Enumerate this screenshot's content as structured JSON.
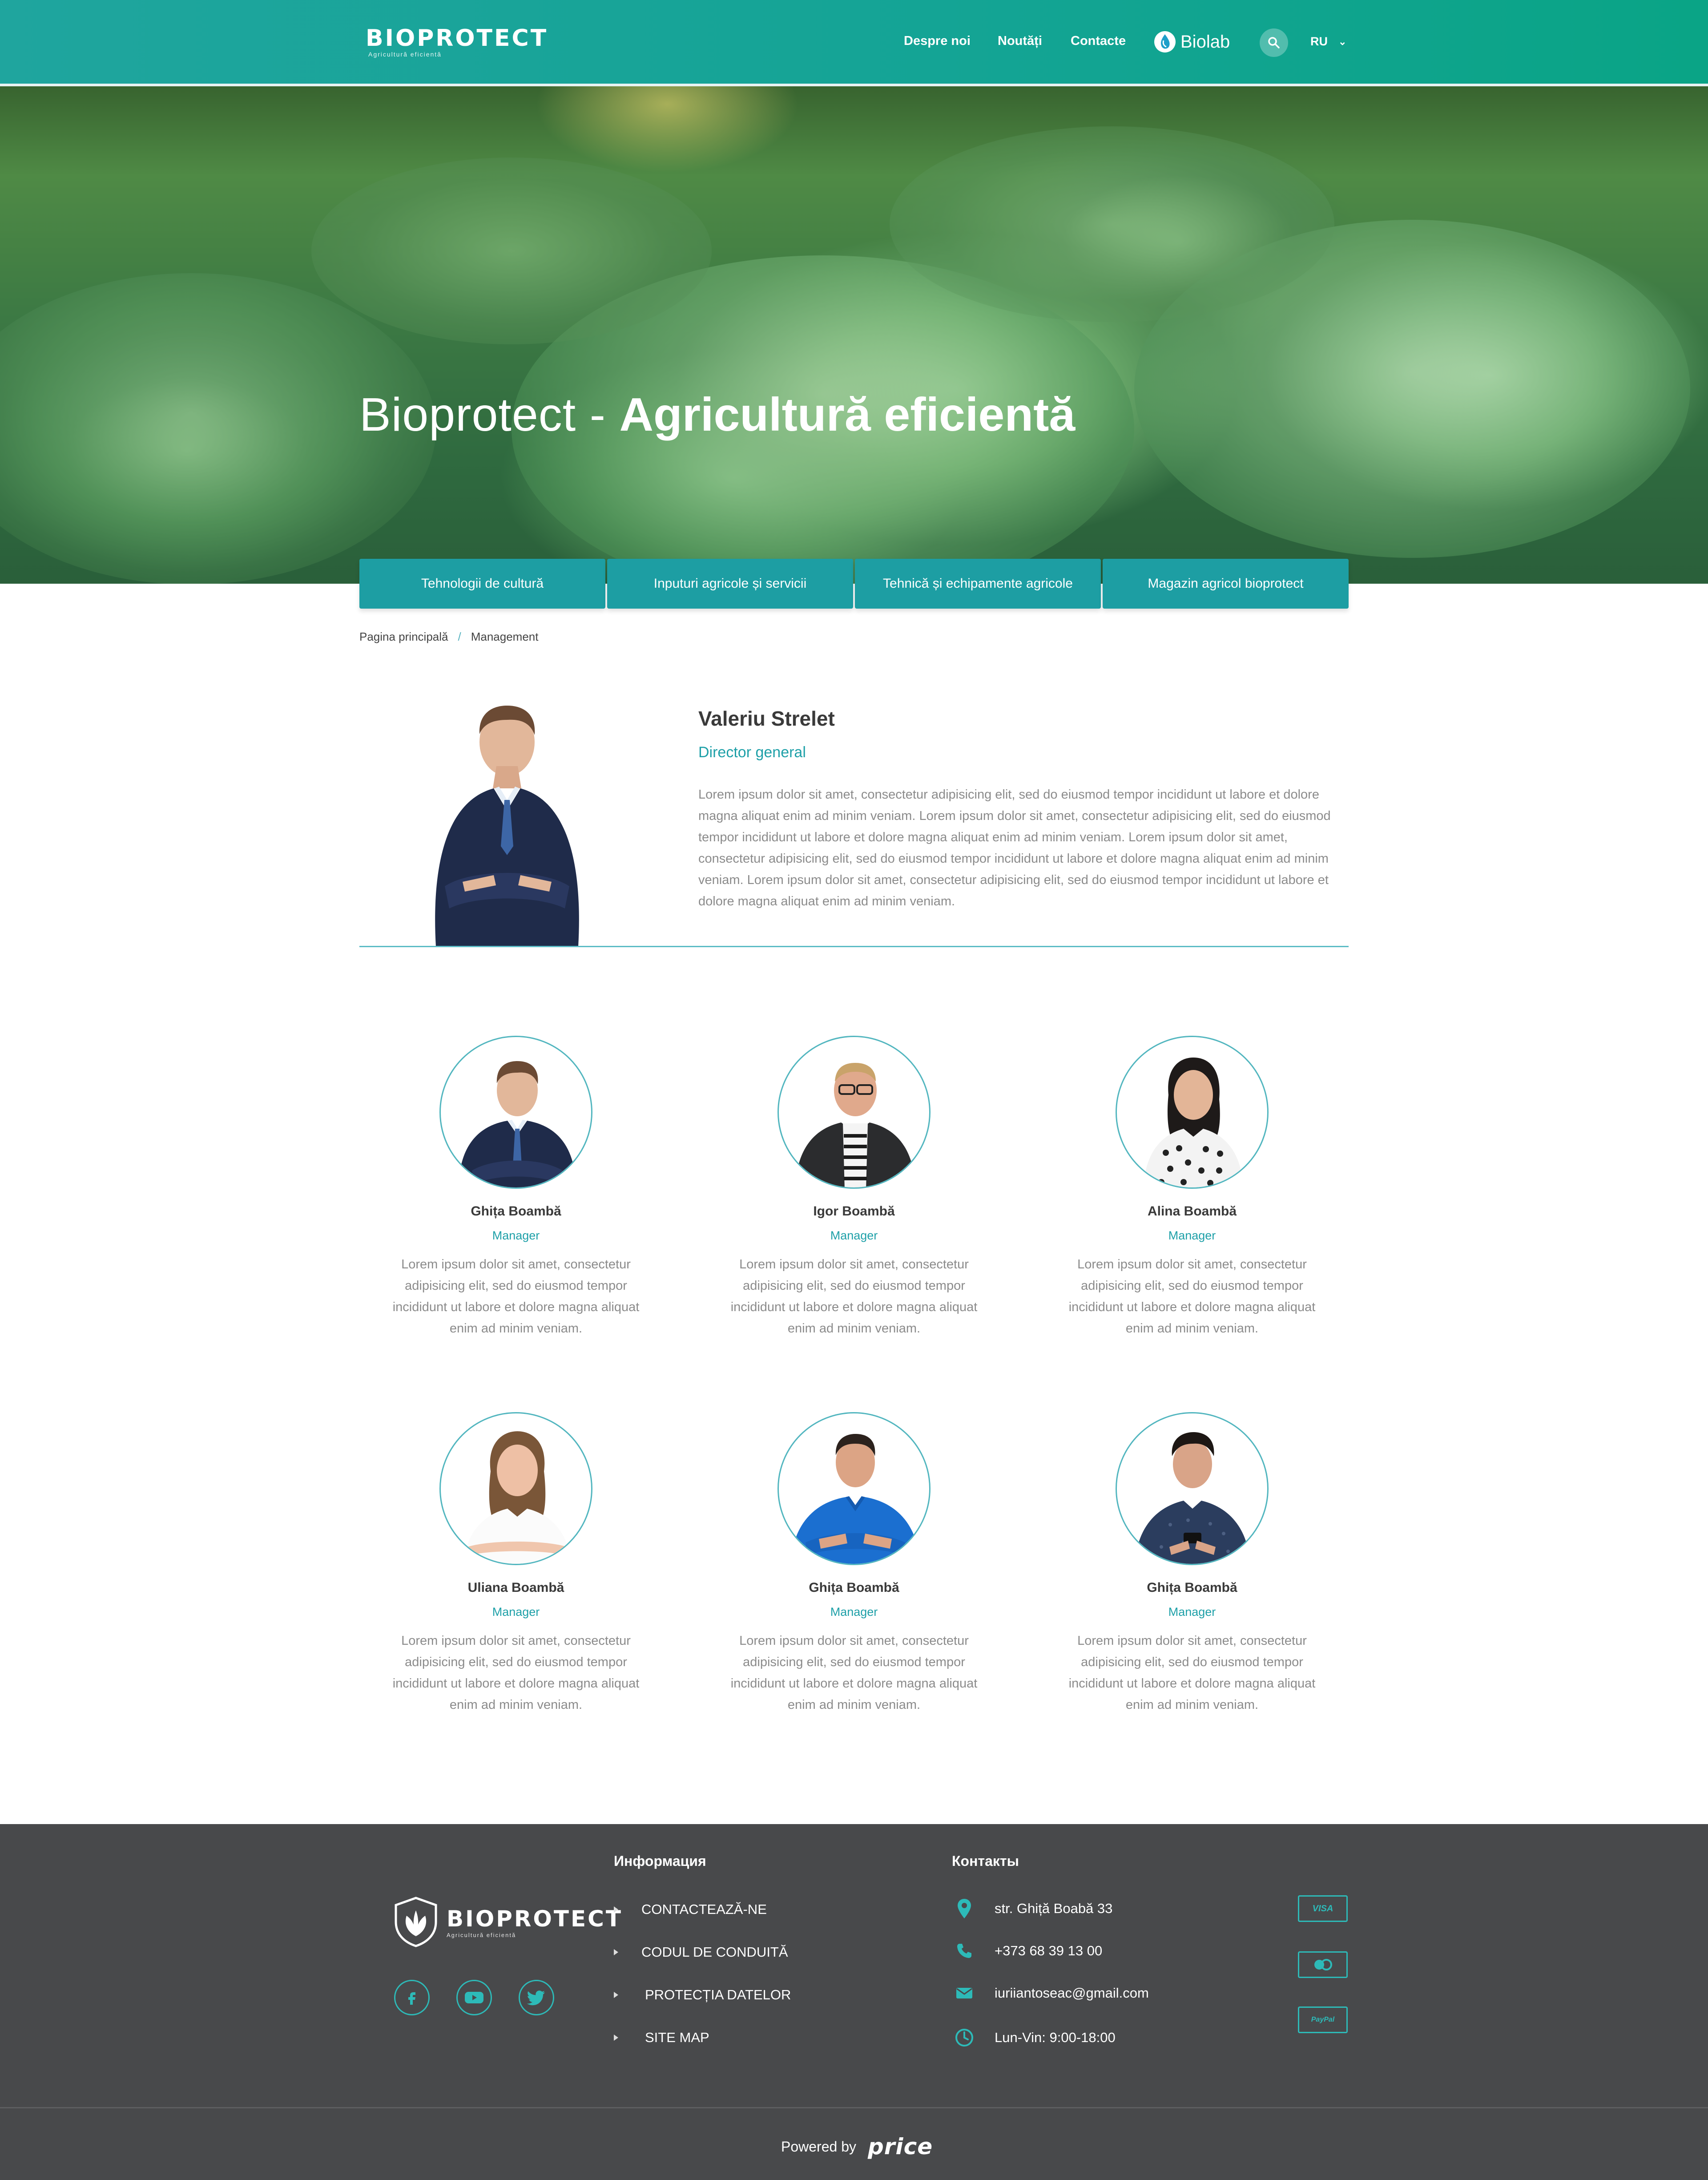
{
  "header": {
    "logo_brand": "BIOPROTECT",
    "logo_tagline": "Agricultură eficientă",
    "nav": [
      "Despre noi",
      "Noutăți",
      "Contacte"
    ],
    "biolab_label": "Biolab",
    "language": "RU"
  },
  "hero": {
    "title_light": "Bioprotect - ",
    "title_bold": "Agricultură eficientă"
  },
  "categories": [
    "Tehnologii de cultură",
    "Inputuri agricole și servicii",
    "Tehnică și echipamente agricole",
    "Magazin agricol bioprotect"
  ],
  "breadcrumb": {
    "home": "Pagina principală",
    "separator": "/",
    "current": "Management"
  },
  "featured": {
    "name": "Valeriu Strelet",
    "role": "Director general",
    "description": "Lorem ipsum dolor sit amet, consectetur adipisicing elit, sed do eiusmod tempor incididunt ut labore et dolore magna aliquat enim ad minim veniam. Lorem ipsum dolor sit amet, consectetur adipisicing elit, sed do eiusmod tempor incididunt ut labore et dolore magna aliquat enim ad minim veniam. Lorem ipsum dolor sit amet, consectetur adipisicing elit, sed do eiusmod tempor incididunt ut labore et dolore magna aliquat enim ad minim veniam. Lorem ipsum dolor sit amet, consectetur adipisicing elit, sed do eiusmod tempor incididunt ut labore et dolore magna aliquat enim ad minim veniam."
  },
  "team": [
    {
      "name": "Ghița Boambă",
      "role": "Manager",
      "description": "Lorem ipsum dolor sit amet, consectetur adipisicing elit, sed do eiusmod tempor incididunt ut labore et dolore magna aliquat enim ad minim veniam."
    },
    {
      "name": "Igor Boambă",
      "role": "Manager",
      "description": "Lorem ipsum dolor sit amet, consectetur adipisicing elit, sed do eiusmod tempor incididunt ut labore et dolore magna aliquat enim ad minim veniam."
    },
    {
      "name": "Alina Boambă",
      "role": "Manager",
      "description": "Lorem ipsum dolor sit amet, consectetur adipisicing elit, sed do eiusmod tempor incididunt ut labore et dolore magna aliquat enim ad minim veniam."
    },
    {
      "name": "Uliana Boambă",
      "role": "Manager",
      "description": "Lorem ipsum dolor sit amet, consectetur adipisicing elit, sed do eiusmod tempor incididunt ut labore et dolore magna aliquat enim ad minim veniam."
    },
    {
      "name": "Ghița Boambă",
      "role": "Manager",
      "description": "Lorem ipsum dolor sit amet, consectetur adipisicing elit, sed do eiusmod tempor incididunt ut labore et dolore magna aliquat enim ad minim veniam."
    },
    {
      "name": "Ghița Boambă",
      "role": "Manager",
      "description": "Lorem ipsum dolor sit amet, consectetur adipisicing elit, sed do eiusmod tempor incididunt ut labore et dolore magna aliquat enim ad minim veniam."
    }
  ],
  "footer": {
    "logo_brand": "BIOPROTECT",
    "logo_tagline": "Agricultură eficientă",
    "social_icons": [
      "facebook-icon",
      "youtube-icon",
      "twitter-icon"
    ],
    "info_heading": "Информация",
    "info_links": [
      "CONTACTEAZĂ-NE",
      "CODUL DE CONDUITĂ",
      "PROTECȚIA DATELOR",
      "SITE MAP"
    ],
    "contacts_heading": "Контакты",
    "contacts": {
      "address": "str. Ghiță Boabă 33",
      "phone": "+373 68 39 13 00",
      "email": "iuriiantoseac@gmail.com",
      "hours": "Lun-Vin: 9:00-18:00"
    },
    "payments": [
      "VISA",
      "",
      "PayPal"
    ],
    "powered_by": "Powered by",
    "powered_brand": "price"
  },
  "colors": {
    "accent": "#1ea0a8",
    "header_start": "#1fa59e",
    "header_end": "#0aa486",
    "category_button": "#1d9ea3",
    "footer_bg": "#48494b",
    "footer_accent": "#2dbab8"
  }
}
